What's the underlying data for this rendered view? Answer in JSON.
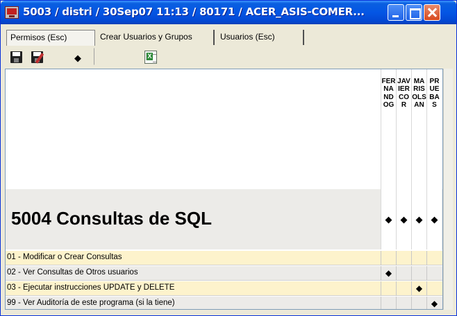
{
  "window": {
    "title": "5003 / distri / 30Sep07 11:13 / 80171 / ACER_ASIS-COMER...",
    "minimize_icon": "minimize-icon",
    "maximize_icon": "maximize-icon",
    "close_icon": "close-icon"
  },
  "tabs": [
    {
      "label": "Permisos (Esc)",
      "active": true
    },
    {
      "label": "Crear Usuarios y Grupos",
      "active": false
    },
    {
      "label": "Usuarios (Esc)",
      "active": false
    }
  ],
  "toolbar": {
    "buttons": [
      {
        "icon": "save-icon"
      },
      {
        "icon": "save-as-icon"
      },
      {
        "icon": "diamond-icon",
        "glyph": "◆"
      },
      {
        "icon": "blank"
      },
      {
        "icon": "excel-export-icon",
        "glyph": "X"
      }
    ]
  },
  "users": [
    "FERNANDOG",
    "JAVIERCOR",
    "MARISOLSAN",
    "PRUEBAS"
  ],
  "section": {
    "title": "5004  Consultas de SQL",
    "marks": [
      "◆",
      "◆",
      "◆",
      "◆"
    ]
  },
  "rows": [
    {
      "label": "01 - Modificar o Crear Consultas",
      "marks": [
        "",
        "",
        "",
        ""
      ]
    },
    {
      "label": "02 - Ver Consultas de Otros usuarios",
      "marks": [
        "◆",
        "",
        "",
        ""
      ]
    },
    {
      "label": "03 - Ejecutar instrucciones UPDATE y DELETE",
      "marks": [
        "",
        "",
        "◆",
        ""
      ]
    },
    {
      "label": "99 - Ver Auditoría de este programa (si la tiene)",
      "marks": [
        "",
        "",
        "",
        "◆"
      ]
    }
  ]
}
